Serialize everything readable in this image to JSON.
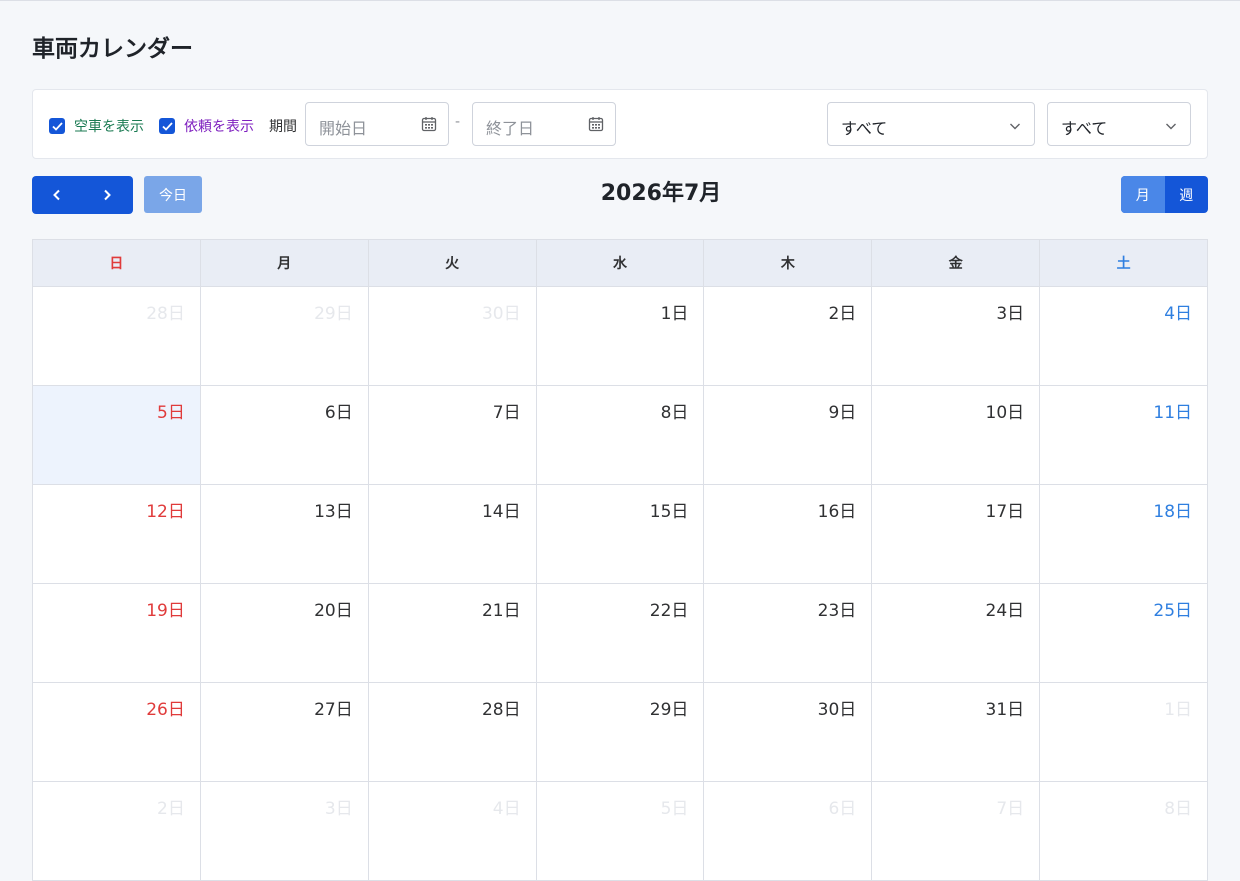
{
  "page": {
    "title": "車両カレンダー"
  },
  "filters": {
    "show_vacant_label": "空車を表示",
    "show_request_label": "依頼を表示",
    "period_label": "期間",
    "start_placeholder": "開始日",
    "end_placeholder": "終了日",
    "separator": "-",
    "select1_value": "すべて",
    "select2_value": "すべて"
  },
  "toolbar": {
    "today_label": "今日",
    "month_title": "2026年7月",
    "view_month_label": "月",
    "view_week_label": "週"
  },
  "colors": {
    "accent": "#1456d8",
    "sunday": "#e03b3b",
    "saturday": "#2f7fe0",
    "vacant": "#1a7a52",
    "request": "#7e1fbf"
  },
  "calendar": {
    "weekdays": [
      "日",
      "月",
      "火",
      "水",
      "木",
      "金",
      "土"
    ],
    "weeks": [
      [
        {
          "label": "28日",
          "other": true
        },
        {
          "label": "29日",
          "other": true
        },
        {
          "label": "30日",
          "other": true
        },
        {
          "label": "1日"
        },
        {
          "label": "2日"
        },
        {
          "label": "3日"
        },
        {
          "label": "4日"
        }
      ],
      [
        {
          "label": "5日",
          "today": true
        },
        {
          "label": "6日"
        },
        {
          "label": "7日"
        },
        {
          "label": "8日"
        },
        {
          "label": "9日"
        },
        {
          "label": "10日"
        },
        {
          "label": "11日"
        }
      ],
      [
        {
          "label": "12日"
        },
        {
          "label": "13日"
        },
        {
          "label": "14日"
        },
        {
          "label": "15日"
        },
        {
          "label": "16日"
        },
        {
          "label": "17日"
        },
        {
          "label": "18日"
        }
      ],
      [
        {
          "label": "19日"
        },
        {
          "label": "20日"
        },
        {
          "label": "21日"
        },
        {
          "label": "22日"
        },
        {
          "label": "23日"
        },
        {
          "label": "24日"
        },
        {
          "label": "25日"
        }
      ],
      [
        {
          "label": "26日"
        },
        {
          "label": "27日"
        },
        {
          "label": "28日"
        },
        {
          "label": "29日"
        },
        {
          "label": "30日"
        },
        {
          "label": "31日"
        },
        {
          "label": "1日",
          "other": true
        }
      ],
      [
        {
          "label": "2日",
          "other": true
        },
        {
          "label": "3日",
          "other": true
        },
        {
          "label": "4日",
          "other": true
        },
        {
          "label": "5日",
          "other": true
        },
        {
          "label": "6日",
          "other": true
        },
        {
          "label": "7日",
          "other": true
        },
        {
          "label": "8日",
          "other": true
        }
      ]
    ]
  }
}
